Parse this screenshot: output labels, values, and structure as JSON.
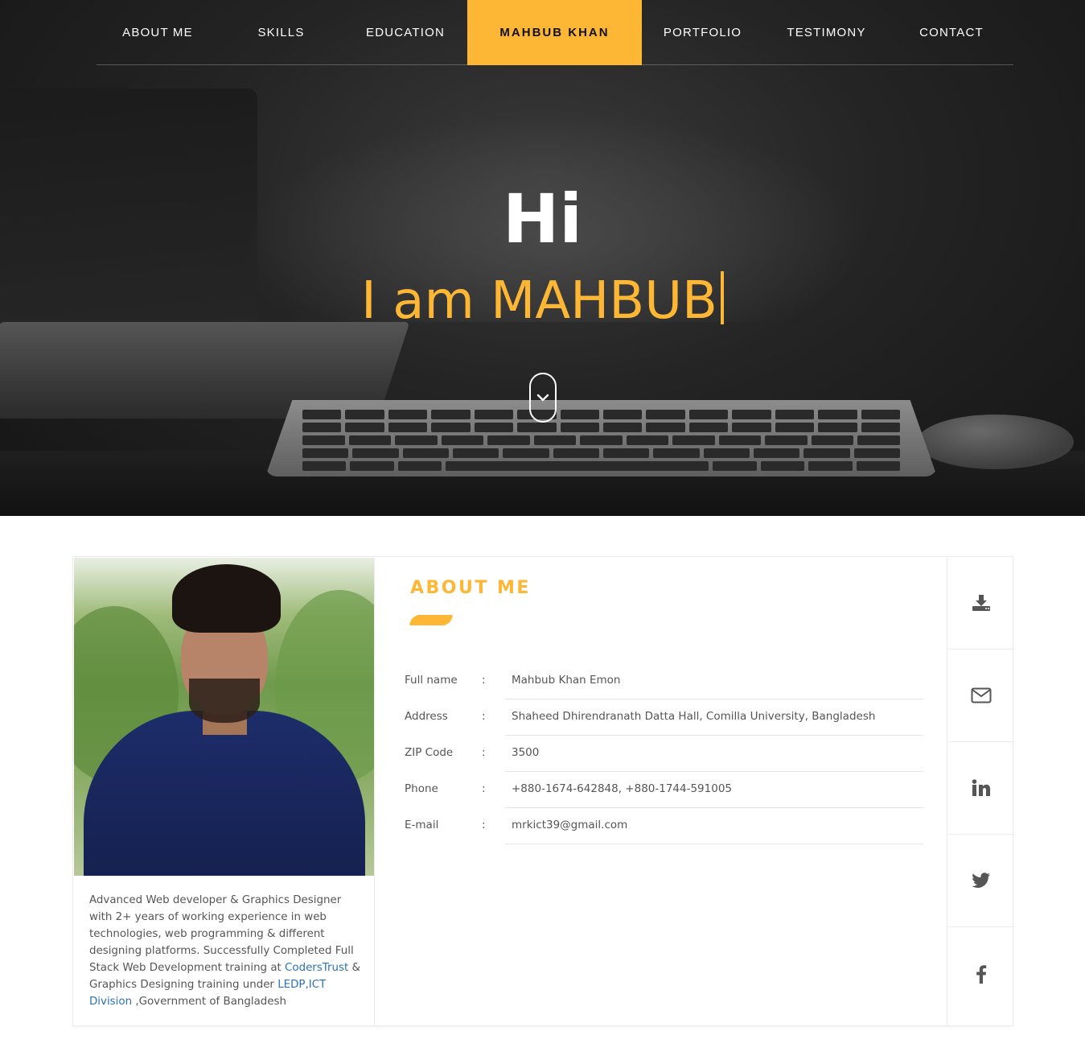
{
  "nav": {
    "items": [
      {
        "label": "ABOUT ME",
        "active": false
      },
      {
        "label": "SKILLS",
        "active": false
      },
      {
        "label": "EDUCATION",
        "active": false
      },
      {
        "label": "MAHBUB KHAN",
        "active": true
      },
      {
        "label": "PORTFOLIO",
        "active": false
      },
      {
        "label": "TESTIMONY",
        "active": false
      },
      {
        "label": "CONTACT",
        "active": false
      }
    ]
  },
  "hero": {
    "greeting": "Hi",
    "tagline": "I am MAHBUB",
    "scroll_icon": "chevron-down-icon"
  },
  "about": {
    "title": "ABOUT ME",
    "rows": [
      {
        "label": "Full name",
        "sep": ":",
        "value": "Mahbub Khan Emon"
      },
      {
        "label": "Address",
        "sep": ":",
        "value": "Shaheed Dhirendranath Datta Hall, Comilla University, Bangladesh"
      },
      {
        "label": "ZIP Code",
        "sep": ":",
        "value": "3500"
      },
      {
        "label": "Phone",
        "sep": ":",
        "value": "+880-1674-642848, +880-1744-591005"
      },
      {
        "label": "E-mail",
        "sep": ":",
        "value": "mrkict39@gmail.com"
      }
    ],
    "bio": {
      "part1": "Advanced Web developer & Graphics Designer with 2+ years of working experience in web technologies, web programming & different designing platforms. Successfully Completed Full Stack Web Development training at ",
      "link1": "CodersTrust",
      "part2": " & Graphics Designing training under ",
      "link2": "LEDP,ICT Division",
      "part3": " ,Government of Bangladesh"
    }
  },
  "social": [
    {
      "icon": "download-icon"
    },
    {
      "icon": "mail-icon"
    },
    {
      "icon": "linkedin-icon"
    },
    {
      "icon": "twitter-icon"
    },
    {
      "icon": "facebook-icon"
    }
  ],
  "colors": {
    "accent": "#fdb735",
    "text": "#555555",
    "link": "#2a72b5"
  }
}
